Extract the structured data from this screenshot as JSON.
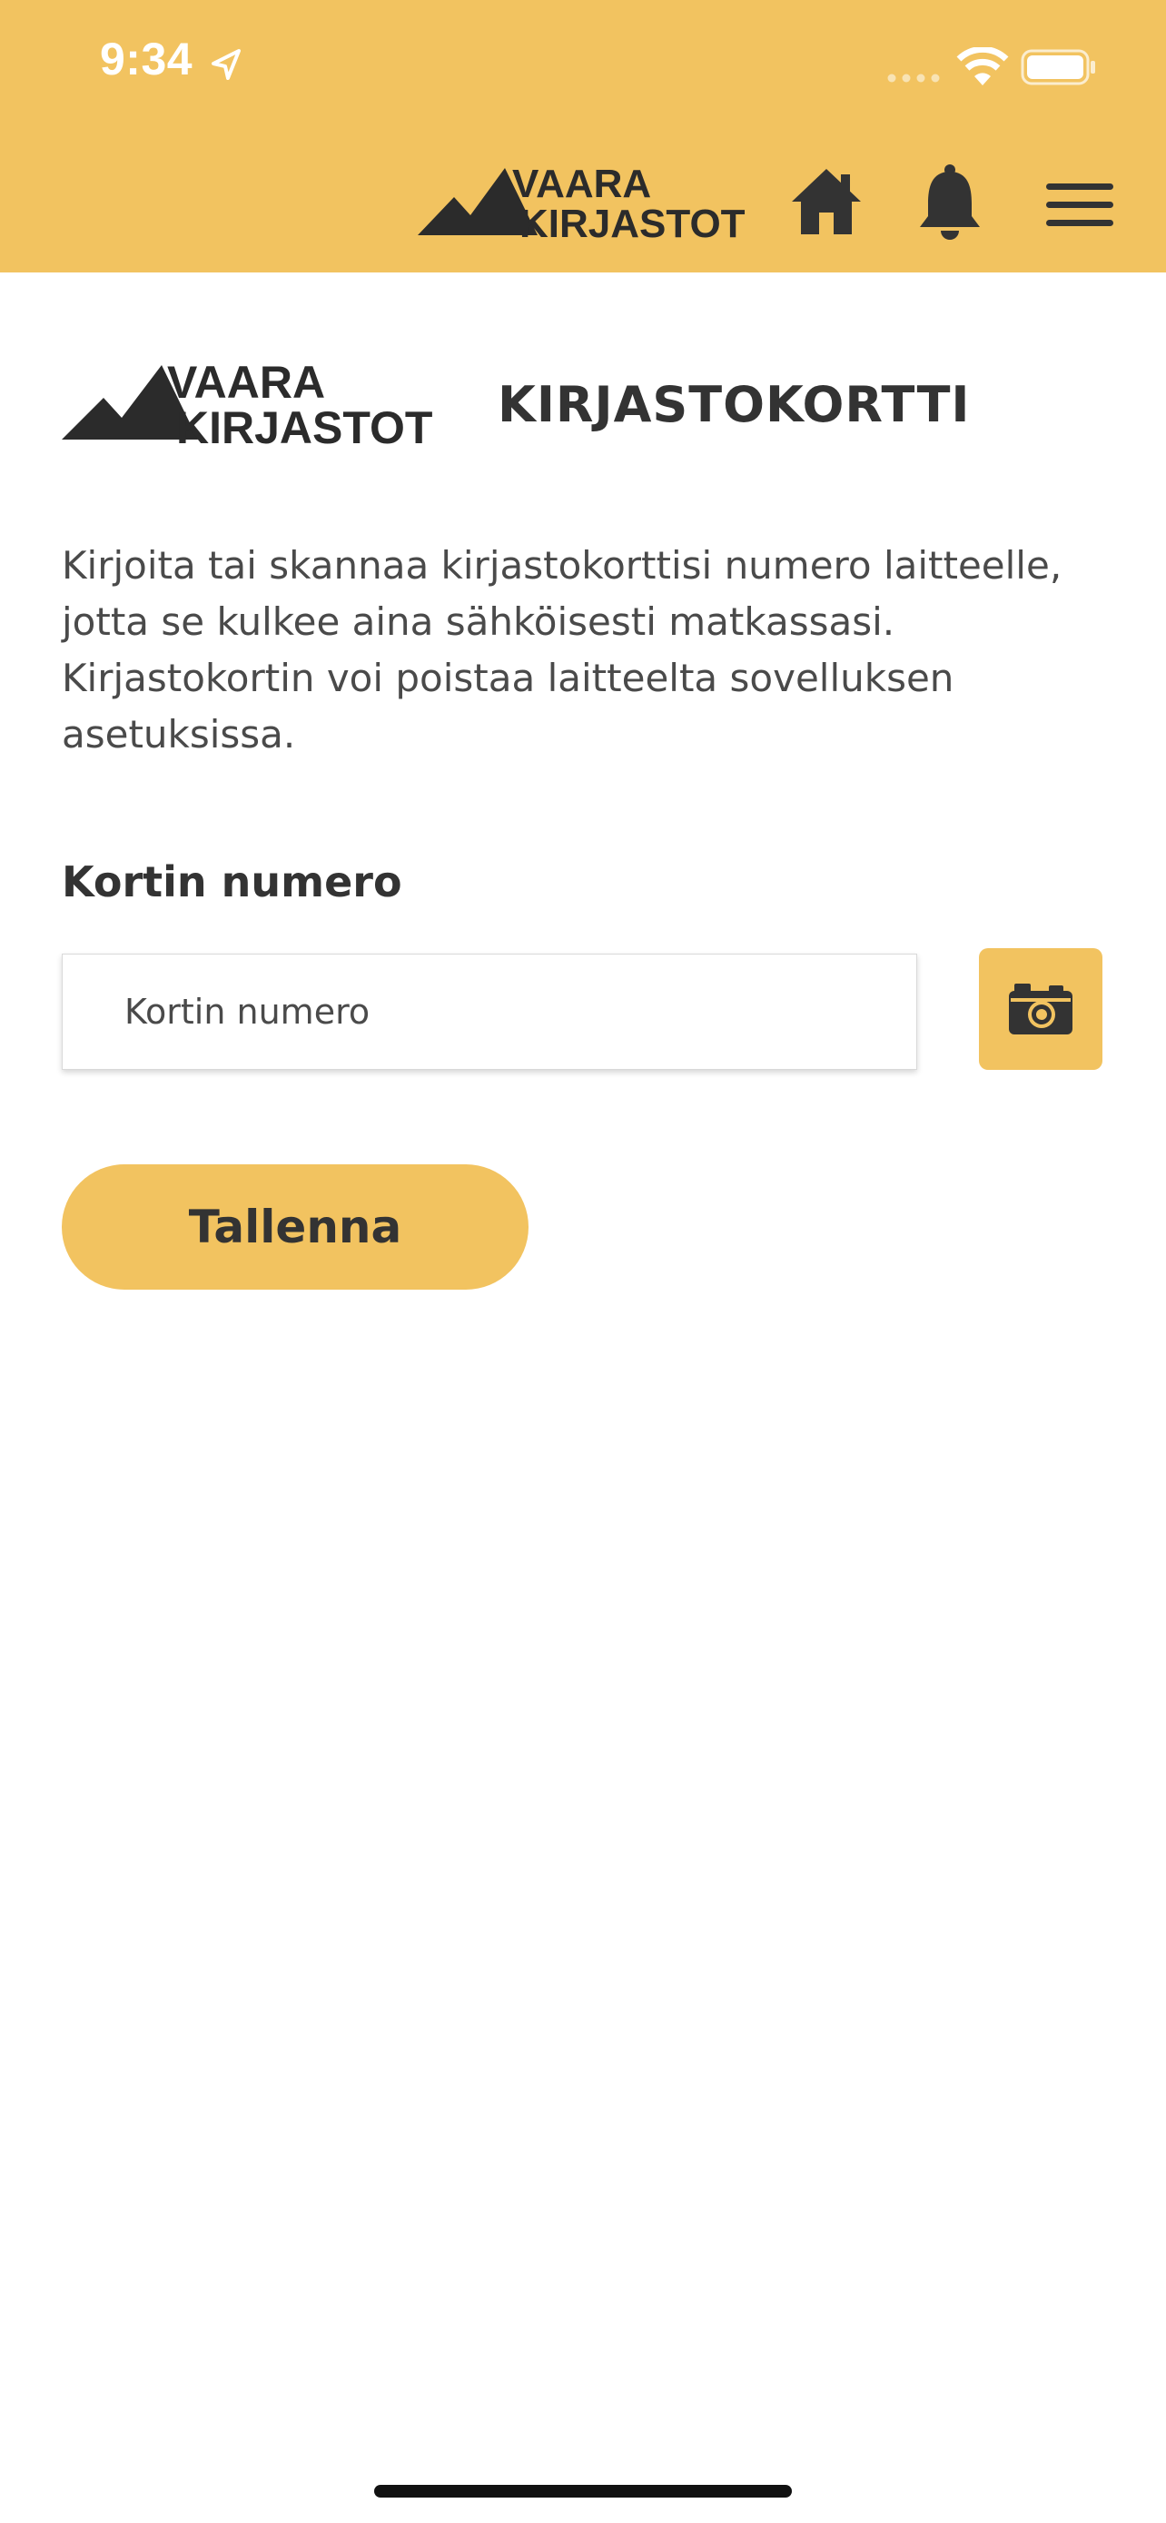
{
  "status_bar": {
    "time": "9:34"
  },
  "header": {
    "logo_line1": "VAARA",
    "logo_line2": "KIRJASTOT",
    "background_color": "#f2c360",
    "icons": [
      "home-icon",
      "bell-icon",
      "menu-icon"
    ]
  },
  "page": {
    "logo_line1": "VAARA",
    "logo_line2": "KIRJASTOT",
    "title": "KIRJASTOKORTTI",
    "intro_lines": [
      "Kirjoita tai skannaa kirjastokorttisi numero laitteelle,",
      "jotta se kulkee aina sähköisesti matkassasi.",
      "Kirjastokortin voi poistaa laitteelta sovelluksen",
      "asetuksissa."
    ]
  },
  "form": {
    "card_number_label": "Kortin numero",
    "card_number_placeholder": "Kortin numero",
    "card_number_value": "",
    "camera_icon": "camera-icon",
    "save_label": "Tallenna"
  },
  "colors": {
    "accent": "#f2c360",
    "text_dark": "#333333",
    "background": "#ffffff"
  }
}
